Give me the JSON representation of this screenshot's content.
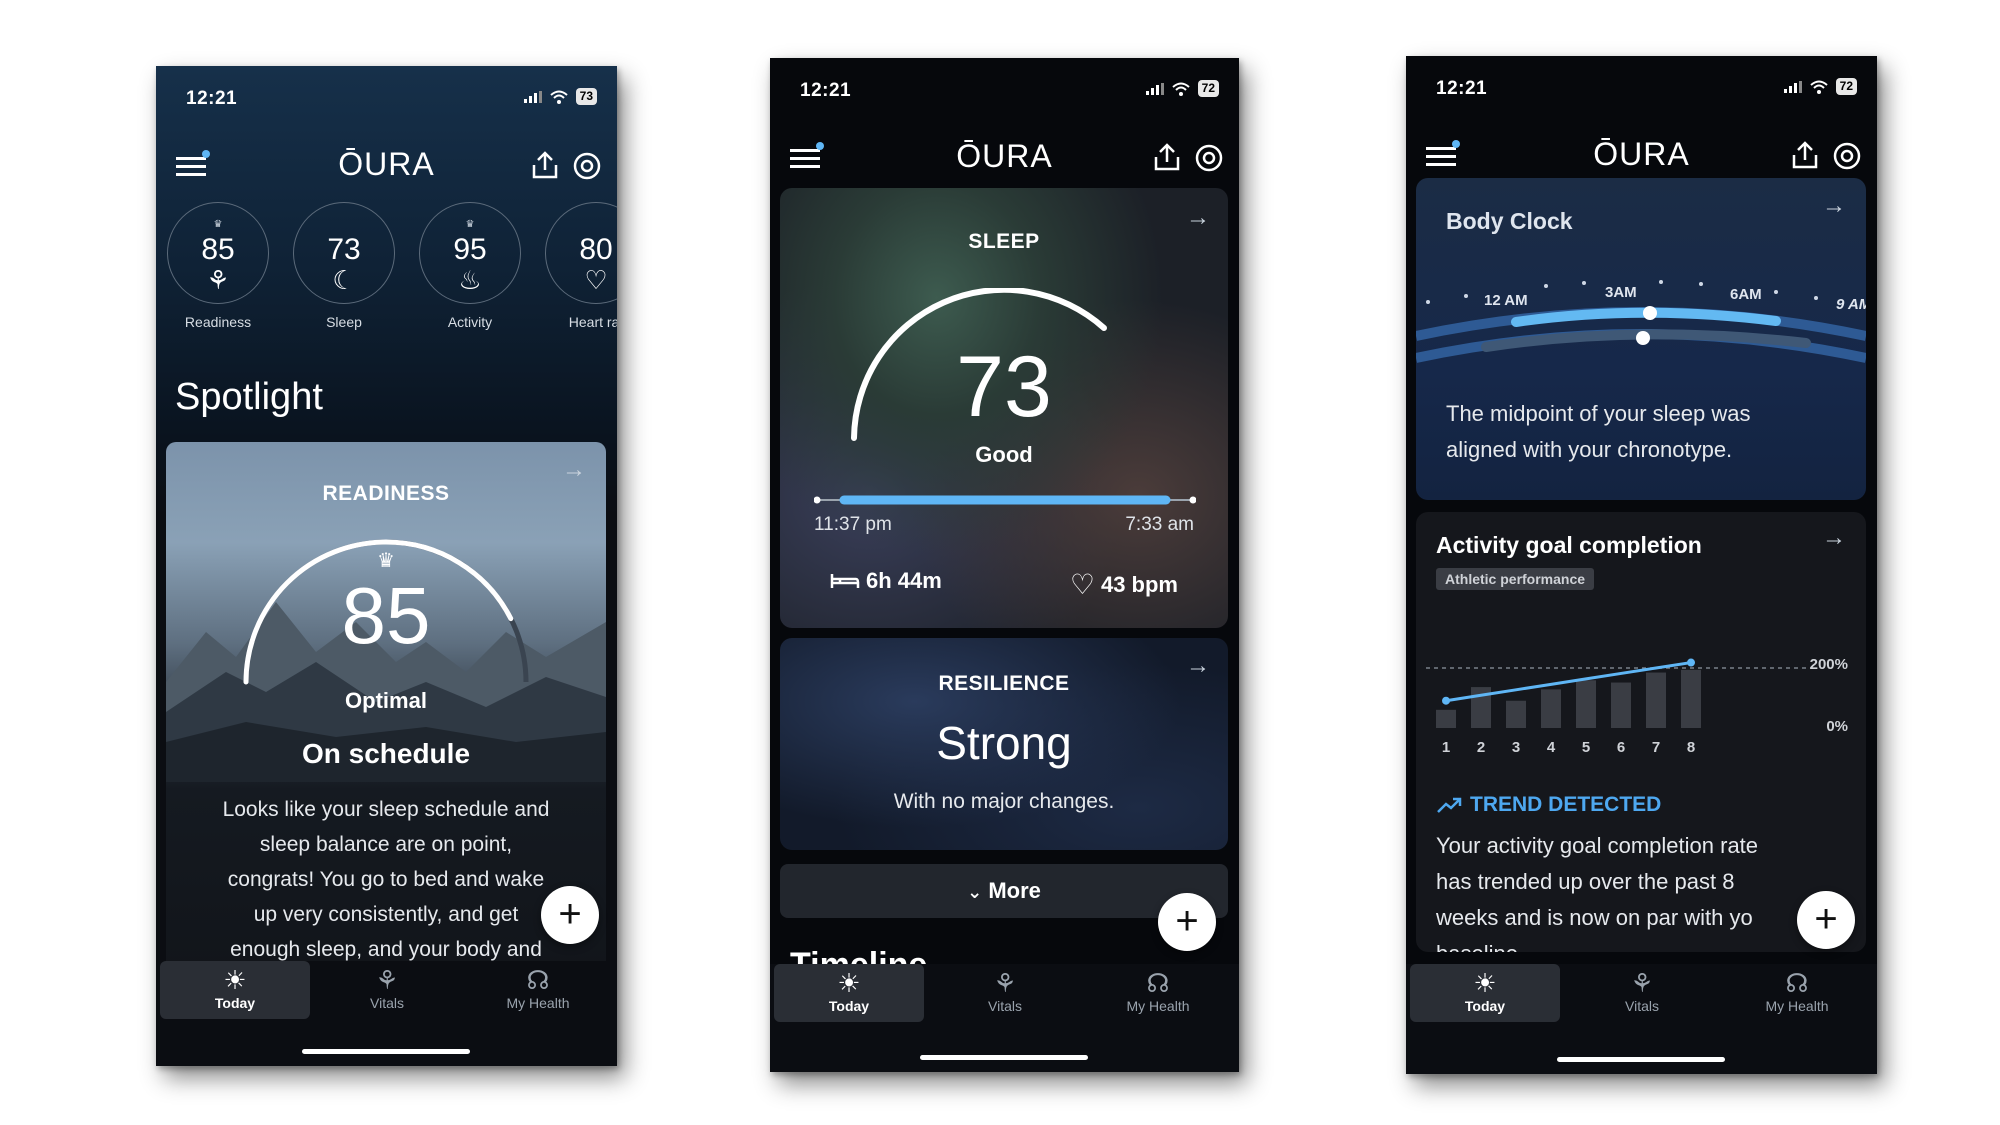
{
  "phones": [
    {
      "status": {
        "time": "12:21",
        "battery": "73"
      },
      "logo": "ŌURA",
      "scores": [
        {
          "value": "85",
          "label": "Readiness",
          "crown": true
        },
        {
          "value": "73",
          "label": "Sleep",
          "crown": false
        },
        {
          "value": "95",
          "label": "Activity",
          "crown": true
        },
        {
          "value": "80",
          "label": "Heart rat",
          "crown": false
        }
      ],
      "spotlight_title": "Spotlight",
      "readiness_card": {
        "title": "READINESS",
        "score": "85",
        "score_fraction": 0.85,
        "status": "Optimal",
        "headline": "On schedule",
        "body": [
          "Looks like your sleep schedule and",
          "sleep balance are on point,",
          "congrats! You go to bed and wake",
          "up very consistently, and get",
          "enough sleep, and your body and"
        ]
      },
      "nav": [
        "Today",
        "Vitals",
        "My Health"
      ]
    },
    {
      "status": {
        "time": "12:21",
        "battery": "72"
      },
      "logo": "ŌURA",
      "sleep_card": {
        "title": "SLEEP",
        "score": "73",
        "status": "Good",
        "bedtime": "11:37 pm",
        "waketime": "7:33 am",
        "duration": "6h 44m",
        "heart_rate": "43 bpm"
      },
      "resilience_card": {
        "title": "RESILIENCE",
        "level": "Strong",
        "subtitle": "With no major changes."
      },
      "more_label": "More",
      "cutoff_heading": "Timeline",
      "nav": [
        "Today",
        "Vitals",
        "My Health"
      ]
    },
    {
      "status": {
        "time": "12:21",
        "battery": "72"
      },
      "logo": "ŌURA",
      "body_clock": {
        "title": "Body Clock",
        "times": [
          "12 AM",
          "3AM",
          "6AM",
          "9 AM"
        ],
        "body": [
          "The midpoint of your sleep was",
          "aligned with your chronotype."
        ]
      },
      "activity": {
        "title": "Activity goal completion",
        "tag": "Athletic performance",
        "y_labels": [
          "200%",
          "0%"
        ],
        "trend_label": "TREND DETECTED",
        "body": [
          "Your activity goal completion rate",
          "has trended up over the past 8",
          "weeks and is now on par with yo",
          "baseline."
        ]
      },
      "nav": [
        "Today",
        "Vitals",
        "My Health"
      ]
    }
  ],
  "chart_data": {
    "type": "bar",
    "title": "Activity goal completion",
    "categories": [
      "1",
      "2",
      "3",
      "4",
      "5",
      "6",
      "7",
      "8"
    ],
    "series": [
      {
        "values": [
          40,
          90,
          60,
          85,
          105,
          100,
          122,
          128
        ]
      },
      {
        "values": [
          60,
          72,
          84,
          96,
          108,
          120,
          132,
          144
        ]
      }
    ],
    "y_ticks": [
      "0%",
      "200%"
    ],
    "ylim": [
      0,
      220
    ],
    "grid": false
  },
  "colors": {
    "accent": "#5fb6f5",
    "trend": "#4ea8f0"
  }
}
